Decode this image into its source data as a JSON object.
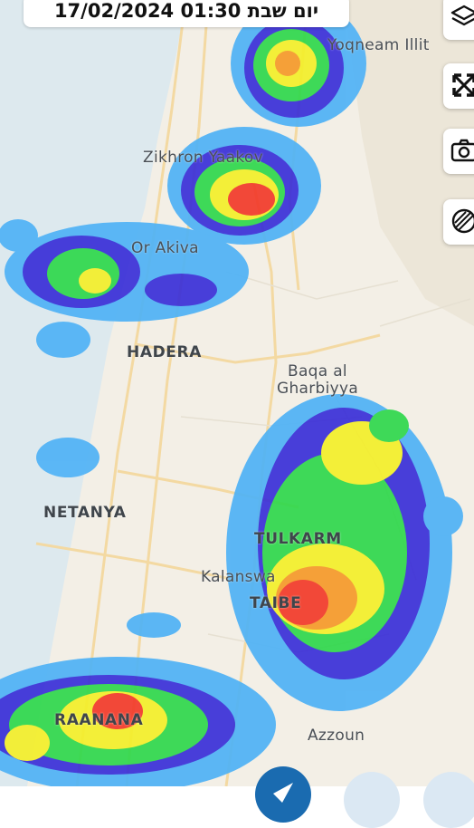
{
  "header": {
    "timestamp": "17/02/2024 01:30 יום שבת"
  },
  "side_buttons": [
    {
      "icon": "layers-icon"
    },
    {
      "icon": "expand-icon"
    },
    {
      "icon": "camera-icon"
    },
    {
      "icon": "radar-icon"
    }
  ],
  "places": {
    "yoqneam": "Yoqneam Illit",
    "zikhron": "Zikhron Yaakov",
    "or_akiva": "Or Akiva",
    "hadera": "HADERA",
    "baqa_1": "Baqa al",
    "baqa_2": "Gharbiyya",
    "netanya": "NETANYA",
    "tulkarm": "TULKARM",
    "kalanswa": "Kalanswa",
    "taibe": "TAIBE",
    "raanana": "RAANANA",
    "azzoun": "Azzoun"
  },
  "colors": {
    "sea": "#dde9ee",
    "land": "#f3efe6",
    "road": "#f3d9a2",
    "radar_light_blue": "#4fb2f6",
    "radar_blue": "#3a2fd8",
    "radar_green": "#2fd84c",
    "radar_yellow": "#f4ef2a",
    "radar_orange": "#f69a2a",
    "radar_red": "#f23a2a",
    "button_blue": "#1a6bb0"
  }
}
